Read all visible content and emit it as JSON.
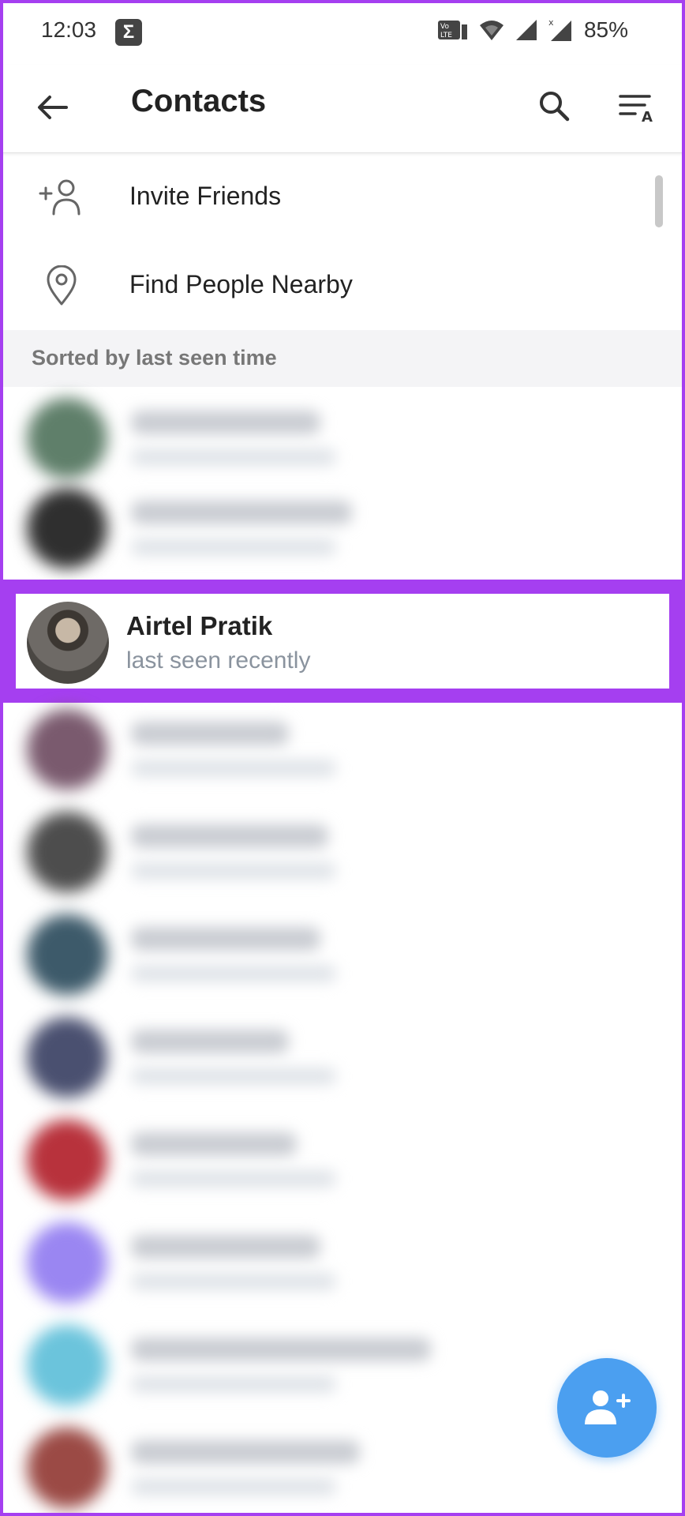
{
  "status_bar": {
    "time": "12:03",
    "notification_icon": "sigma-icon",
    "battery": "85%"
  },
  "app_bar": {
    "title": "Contacts"
  },
  "menu": {
    "items": [
      {
        "label": "Invite Friends",
        "icon": "add-person-icon"
      },
      {
        "label": "Find People Nearby",
        "icon": "location-pin-icon"
      }
    ]
  },
  "section": {
    "header": "Sorted by last seen time"
  },
  "highlighted_contact": {
    "name": "Airtel Pratik",
    "status": "last seen recently"
  },
  "blurred_contacts": [
    {
      "avatar_color": "#5f7f6a"
    },
    {
      "avatar_color": "#2f2f2f"
    },
    {
      "avatar_color": "#7a5a6e"
    },
    {
      "avatar_color": "#4d4d4d"
    },
    {
      "avatar_color": "#3d5a6a"
    },
    {
      "avatar_color": "#4a5070"
    },
    {
      "avatar_color": "#b8323c"
    },
    {
      "avatar_color": "#9a86f2"
    },
    {
      "avatar_color": "#6bc4dc"
    },
    {
      "avatar_color": "#9b4a45"
    }
  ],
  "colors": {
    "highlight": "#a53ff0",
    "fab": "#4b9ff0",
    "status_gray": "#8a939e"
  },
  "fab": {
    "icon": "add-contact-icon"
  }
}
